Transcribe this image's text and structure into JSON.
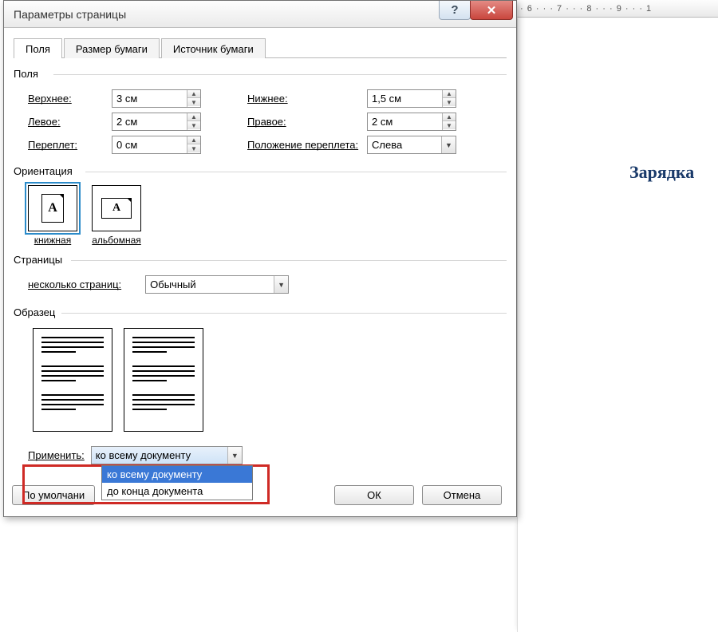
{
  "ruler_text": "· 6 · · · 7 · · · 8 · · · 9 · · · 1",
  "document": {
    "title": "Зарядка"
  },
  "dialog": {
    "title": "Параметры страницы",
    "tabs": [
      "Поля",
      "Размер бумаги",
      "Источник бумаги"
    ],
    "active_tab": 0,
    "group_fields_label": "Поля",
    "fields": {
      "top_label": "Верхнее:",
      "top_value": "3 см",
      "bottom_label": "Нижнее:",
      "bottom_value": "1,5 см",
      "left_label": "Левое:",
      "left_value": "2 см",
      "right_label": "Правое:",
      "right_value": "2 см",
      "gutter_label": "Переплет:",
      "gutter_value": "0 см",
      "gutter_pos_label": "Положение переплета:",
      "gutter_pos_value": "Слева"
    },
    "group_orientation_label": "Ориентация",
    "orientation": {
      "portrait_label": "книжная",
      "landscape_label": "альбомная",
      "selected": "portrait"
    },
    "group_pages_label": "Страницы",
    "pages": {
      "multi_label": "несколько страниц:",
      "multi_value": "Обычный"
    },
    "group_sample_label": "Образец",
    "apply": {
      "label": "Применить:",
      "value": "ко всему документу",
      "options": [
        "ко всему документу",
        "до конца документа"
      ],
      "selected_index": 0
    },
    "buttons": {
      "default": "По умолчани",
      "ok": "ОК",
      "cancel": "Отмена"
    }
  }
}
